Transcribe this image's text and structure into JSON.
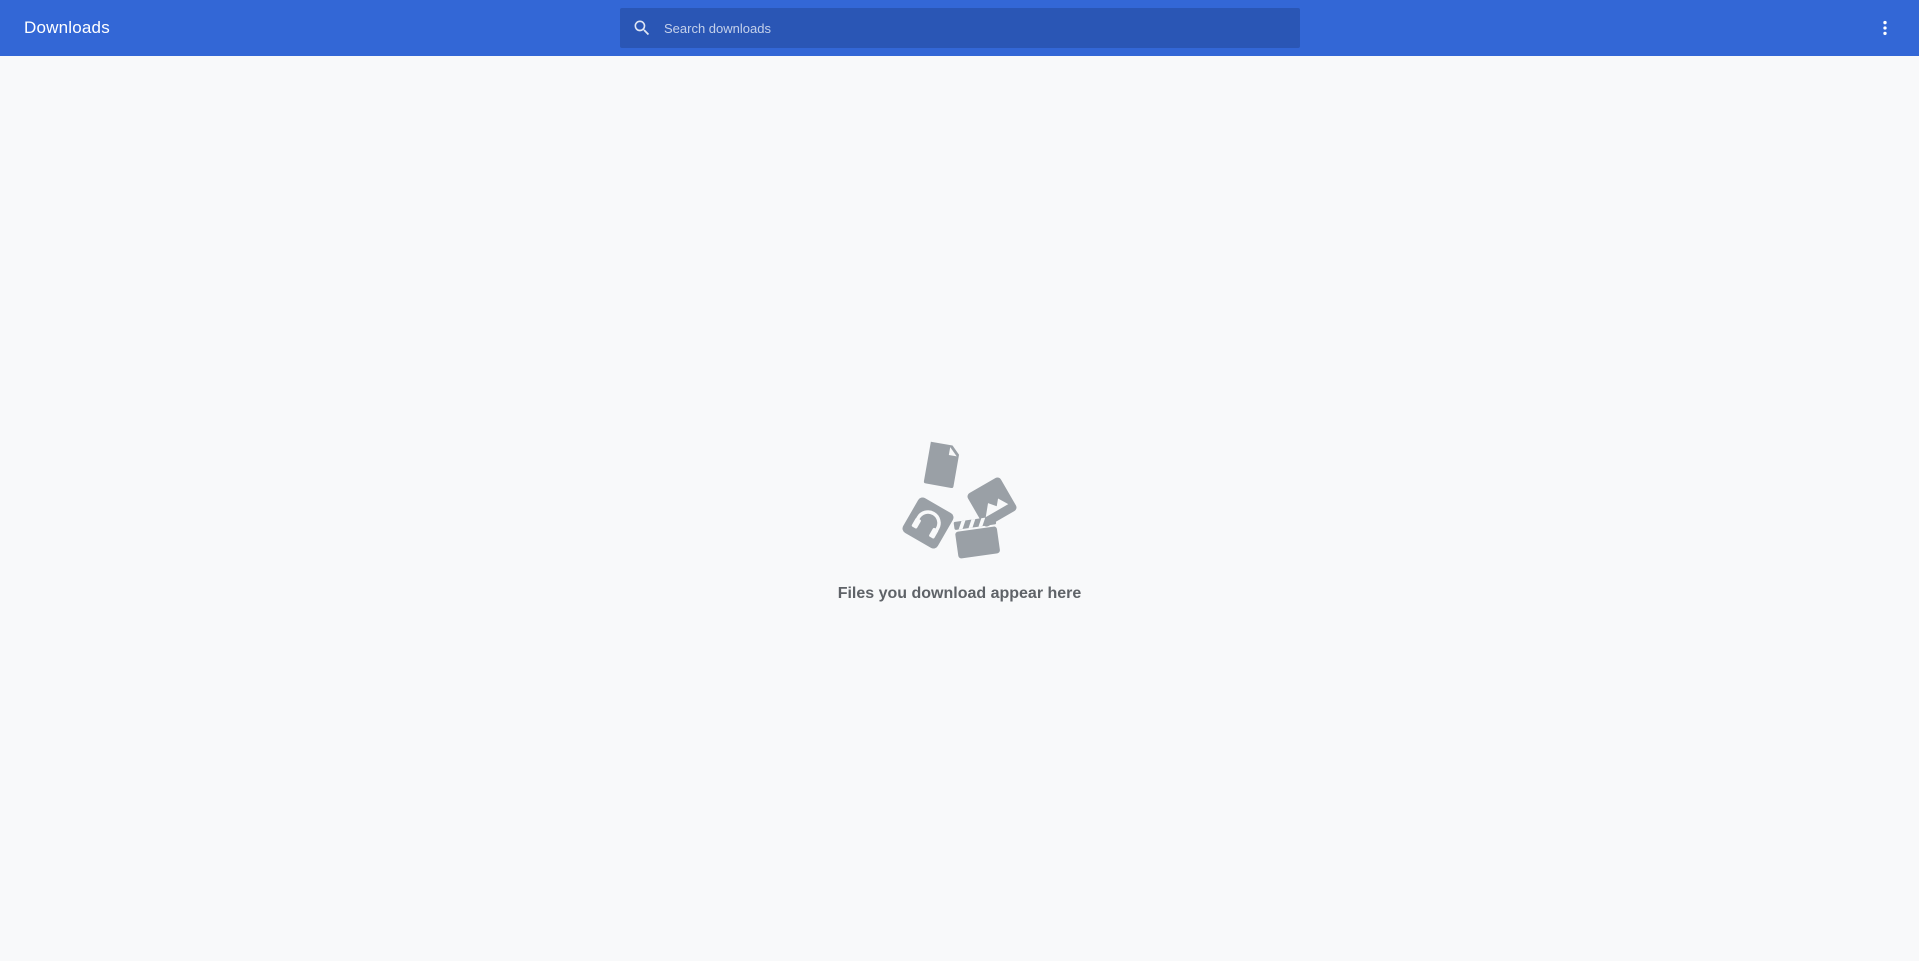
{
  "header": {
    "title": "Downloads",
    "background_color": "#3367d6",
    "search": {
      "placeholder": "Search downloads",
      "value": "",
      "icon": "search-icon"
    },
    "menu_icon": "more-vert-icon"
  },
  "empty_state": {
    "message": "Files you download appear here",
    "illustration_color": "#9aa0a6",
    "icons": [
      "file-icon",
      "image-icon",
      "audio-icon",
      "video-icon"
    ]
  }
}
